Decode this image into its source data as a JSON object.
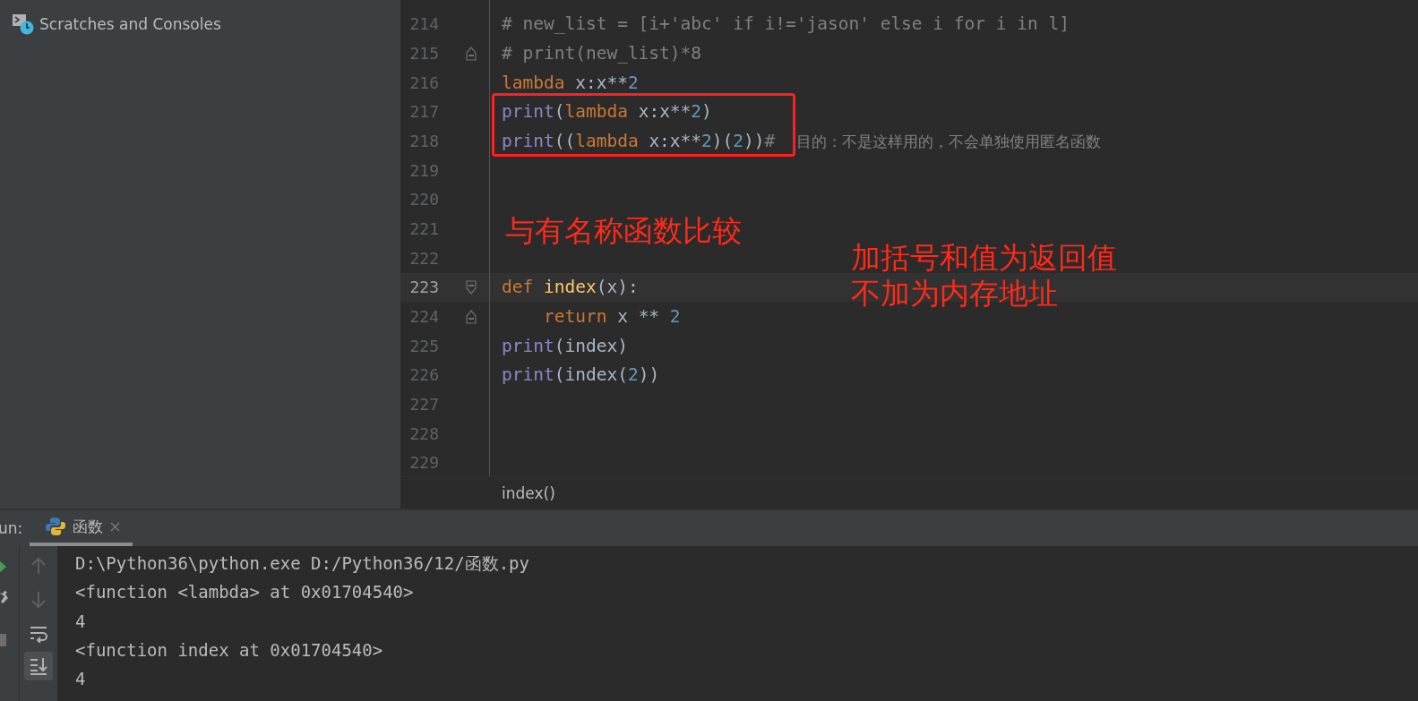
{
  "sidebar": {
    "items": [
      {
        "label": "Scratches and Consoles",
        "kind": "scratches"
      }
    ]
  },
  "editor": {
    "lines": [
      {
        "number": "214",
        "tokens": [
          {
            "kind": "comment",
            "text": "# new_list = [i+'abc' if i!='jason' else i for i in l]"
          }
        ]
      },
      {
        "number": "215",
        "fold_end": true,
        "tokens": [
          {
            "kind": "comment",
            "text": "# print(new_list)*8"
          }
        ]
      },
      {
        "number": "216",
        "tokens": [
          {
            "kind": "keyword",
            "text": "lambda"
          },
          {
            "kind": "plain",
            "text": " x:x**"
          },
          {
            "kind": "number",
            "text": "2"
          }
        ]
      },
      {
        "number": "217",
        "boxed": true,
        "tokens": [
          {
            "kind": "builtin",
            "text": "print"
          },
          {
            "kind": "plain",
            "text": "("
          },
          {
            "kind": "keyword",
            "text": "lambda"
          },
          {
            "kind": "plain",
            "text": " x:x**"
          },
          {
            "kind": "number",
            "text": "2"
          },
          {
            "kind": "plain",
            "text": ")"
          }
        ]
      },
      {
        "number": "218",
        "boxed": true,
        "tokens": [
          {
            "kind": "builtin",
            "text": "print"
          },
          {
            "kind": "plain",
            "text": "(("
          },
          {
            "kind": "keyword",
            "text": "lambda"
          },
          {
            "kind": "plain",
            "text": " x:x**"
          },
          {
            "kind": "number",
            "text": "2"
          },
          {
            "kind": "plain",
            "text": ")("
          },
          {
            "kind": "number",
            "text": "2"
          },
          {
            "kind": "plain",
            "text": "))"
          },
          {
            "kind": "comment",
            "text": "# "
          },
          {
            "kind": "comment_cjk",
            "text": "目的：不是这样用的，不会单独使用匿名函数"
          }
        ]
      },
      {
        "number": "219"
      },
      {
        "number": "220"
      },
      {
        "number": "221"
      },
      {
        "number": "222"
      },
      {
        "number": "223",
        "current": true,
        "fold_start": true,
        "tokens": [
          {
            "kind": "keyword",
            "text": "def "
          },
          {
            "kind": "funcname",
            "text": "index"
          },
          {
            "kind": "plain",
            "text": "(x):"
          }
        ]
      },
      {
        "number": "224",
        "fold_end": true,
        "tokens": [
          {
            "kind": "keyword",
            "text": "    return"
          },
          {
            "kind": "plain",
            "text": " x ** "
          },
          {
            "kind": "number",
            "text": "2"
          }
        ]
      },
      {
        "number": "225",
        "tokens": [
          {
            "kind": "builtin",
            "text": "print"
          },
          {
            "kind": "plain",
            "text": "(index)"
          }
        ]
      },
      {
        "number": "226",
        "tokens": [
          {
            "kind": "builtin",
            "text": "print"
          },
          {
            "kind": "plain",
            "text": "(index("
          },
          {
            "kind": "number",
            "text": "2"
          },
          {
            "kind": "plain",
            "text": "))"
          }
        ]
      },
      {
        "number": "227"
      },
      {
        "number": "228"
      },
      {
        "number": "229"
      }
    ],
    "notes": [
      {
        "lines": [
          "与有名称函数比较"
        ]
      },
      {
        "lines": [
          "加括号和值为返回值",
          "不加为内存地址"
        ]
      }
    ],
    "breadcrumb": "index()"
  },
  "run": {
    "label": "un:",
    "tabs": [
      {
        "label": "函数",
        "selected": true
      }
    ],
    "console": [
      "D:\\Python36\\python.exe D:/Python36/12/函数.py",
      "<function <lambda> at 0x01704540>",
      "4",
      "<function index at 0x01704540>",
      "4"
    ]
  }
}
